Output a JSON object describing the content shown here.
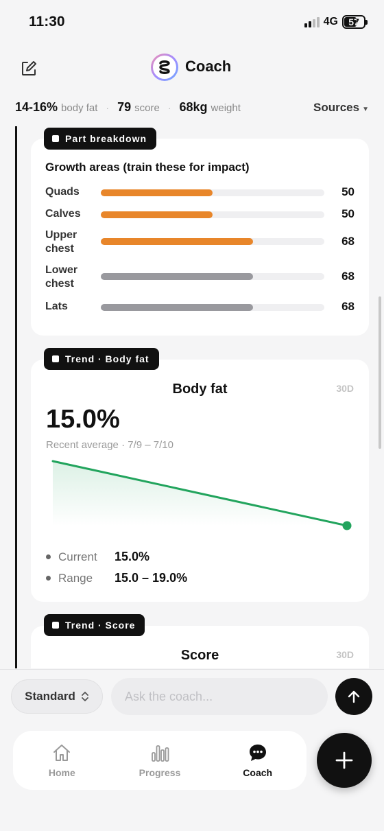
{
  "status_bar": {
    "time": "11:30",
    "network": "4G",
    "battery": "57"
  },
  "header": {
    "title": "Coach"
  },
  "stats": {
    "body_fat_value": "14-16%",
    "body_fat_label": "body fat",
    "score_value": "79",
    "score_label": "score",
    "weight_value": "68kg",
    "weight_label": "weight",
    "sources_label": "Sources"
  },
  "part_breakdown": {
    "tag": "Part breakdown",
    "title": "Growth areas (train these for impact)",
    "rows": [
      {
        "label": "Quads",
        "value": 50,
        "color": "#e8862a"
      },
      {
        "label": "Calves",
        "value": 50,
        "color": "#e8862a"
      },
      {
        "label": "Upper chest",
        "value": 68,
        "color": "#e8862a"
      },
      {
        "label": "Lower chest",
        "value": 68,
        "color": "#99999e"
      },
      {
        "label": "Lats",
        "value": 68,
        "color": "#99999e"
      }
    ]
  },
  "trend_body_fat": {
    "tag": "Trend · Body fat",
    "title": "Body fat",
    "range": "30D",
    "big_value": "15.0%",
    "subtitle": "Recent average · 7/9 – 7/10",
    "current_label": "Current",
    "current_value": "15.0%",
    "range_label": "Range",
    "range_value": "15.0 – 19.0%",
    "line_color": "#22a45d"
  },
  "chart_data": {
    "type": "line",
    "x": [
      "7/9",
      "7/10"
    ],
    "series": [
      {
        "values": [
          19.0,
          15.0
        ]
      }
    ],
    "ylim": [
      15.0,
      19.0
    ],
    "grid": false
  },
  "trend_score": {
    "tag": "Trend · Score",
    "title": "Score",
    "range": "30D"
  },
  "composer": {
    "mode": "Standard",
    "placeholder": "Ask the coach..."
  },
  "nav": {
    "home": "Home",
    "progress": "Progress",
    "coach": "Coach",
    "active": "coach"
  },
  "icons": {
    "edit": "edit-icon",
    "send": "arrow-up-icon",
    "home": "home-icon",
    "progress": "bar-chart-icon",
    "coach": "chat-bubble-icon",
    "fab": "plus-icon"
  }
}
